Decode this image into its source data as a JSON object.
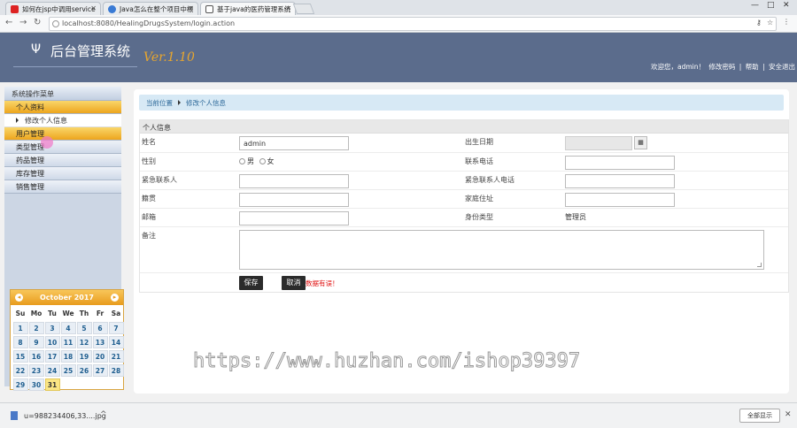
{
  "browser": {
    "tabs": [
      {
        "label": "如何在jsp中调用service",
        "favicon_color": "#d22"
      },
      {
        "label": "Java怎么在整个项目中根",
        "favicon_color": "#3a7bd5"
      },
      {
        "label": "基于java的医药管理系统",
        "favicon_color": "#555"
      }
    ],
    "url": "localhost:8080/HealingDrugsSystem/login.action",
    "window_controls": {
      "minimize": "—",
      "maximize": "□",
      "close": "✕"
    }
  },
  "header": {
    "logo_glyph": "Ψ",
    "title": "后台管理系统",
    "version": "Ver.1.10",
    "welcome": "欢迎您，admin！",
    "links": [
      "修改密码",
      "帮助",
      "安全退出"
    ],
    "separator": "|"
  },
  "sidebar": {
    "title": "系统操作菜单",
    "groups": [
      {
        "label": "个人资料",
        "style": "orange"
      },
      {
        "label": "修改个人信息",
        "style": "sub"
      },
      {
        "label": "用户管理",
        "style": "orange"
      },
      {
        "label": "类型管理",
        "style": "normal"
      },
      {
        "label": "药品管理",
        "style": "normal"
      },
      {
        "label": "库存管理",
        "style": "normal"
      },
      {
        "label": "销售管理",
        "style": "normal"
      }
    ]
  },
  "calendar": {
    "month": "October 2017",
    "prev": "◂",
    "next": "▸",
    "weekdays": [
      "Su",
      "Mo",
      "Tu",
      "We",
      "Th",
      "Fr",
      "Sa"
    ],
    "weeks": [
      [
        "",
        "",
        "",
        "",
        "",
        "",
        ""
      ],
      [
        "1",
        "2",
        "3",
        "4",
        "5",
        "6",
        "7"
      ],
      [
        "8",
        "9",
        "10",
        "11",
        "12",
        "13",
        "14"
      ],
      [
        "15",
        "16",
        "17",
        "18",
        "19",
        "20",
        "21"
      ],
      [
        "22",
        "23",
        "24",
        "25",
        "26",
        "27",
        "28"
      ],
      [
        "29",
        "30",
        "31",
        "",
        "",
        "",
        ""
      ]
    ],
    "today": "31"
  },
  "main": {
    "breadcrumb": [
      "当前位置",
      "修改个人信息"
    ],
    "form_title": "个人信息",
    "fields": {
      "name_label": "姓名",
      "name_value": "admin",
      "birth_label": "出生日期",
      "gender_label": "性别",
      "gender_male": "男",
      "gender_female": "女",
      "phone_label": "联系电话",
      "emergency_label": "紧急联系人",
      "emergency_phone_label": "紧急联系人电话",
      "native_label": "籍贯",
      "address_label": "家庭住址",
      "email_label": "邮箱",
      "role_label": "身份类型",
      "role_value": "管理员",
      "remark_label": "备注"
    },
    "save_button": "保存",
    "cancel_button": "取消",
    "error_message": "数据有误！"
  },
  "watermark": "https://www.huzhan.com/ishop39397",
  "download": {
    "file": "u=988234406,33....jpg",
    "show_all": "全部显示",
    "close": "✕"
  }
}
